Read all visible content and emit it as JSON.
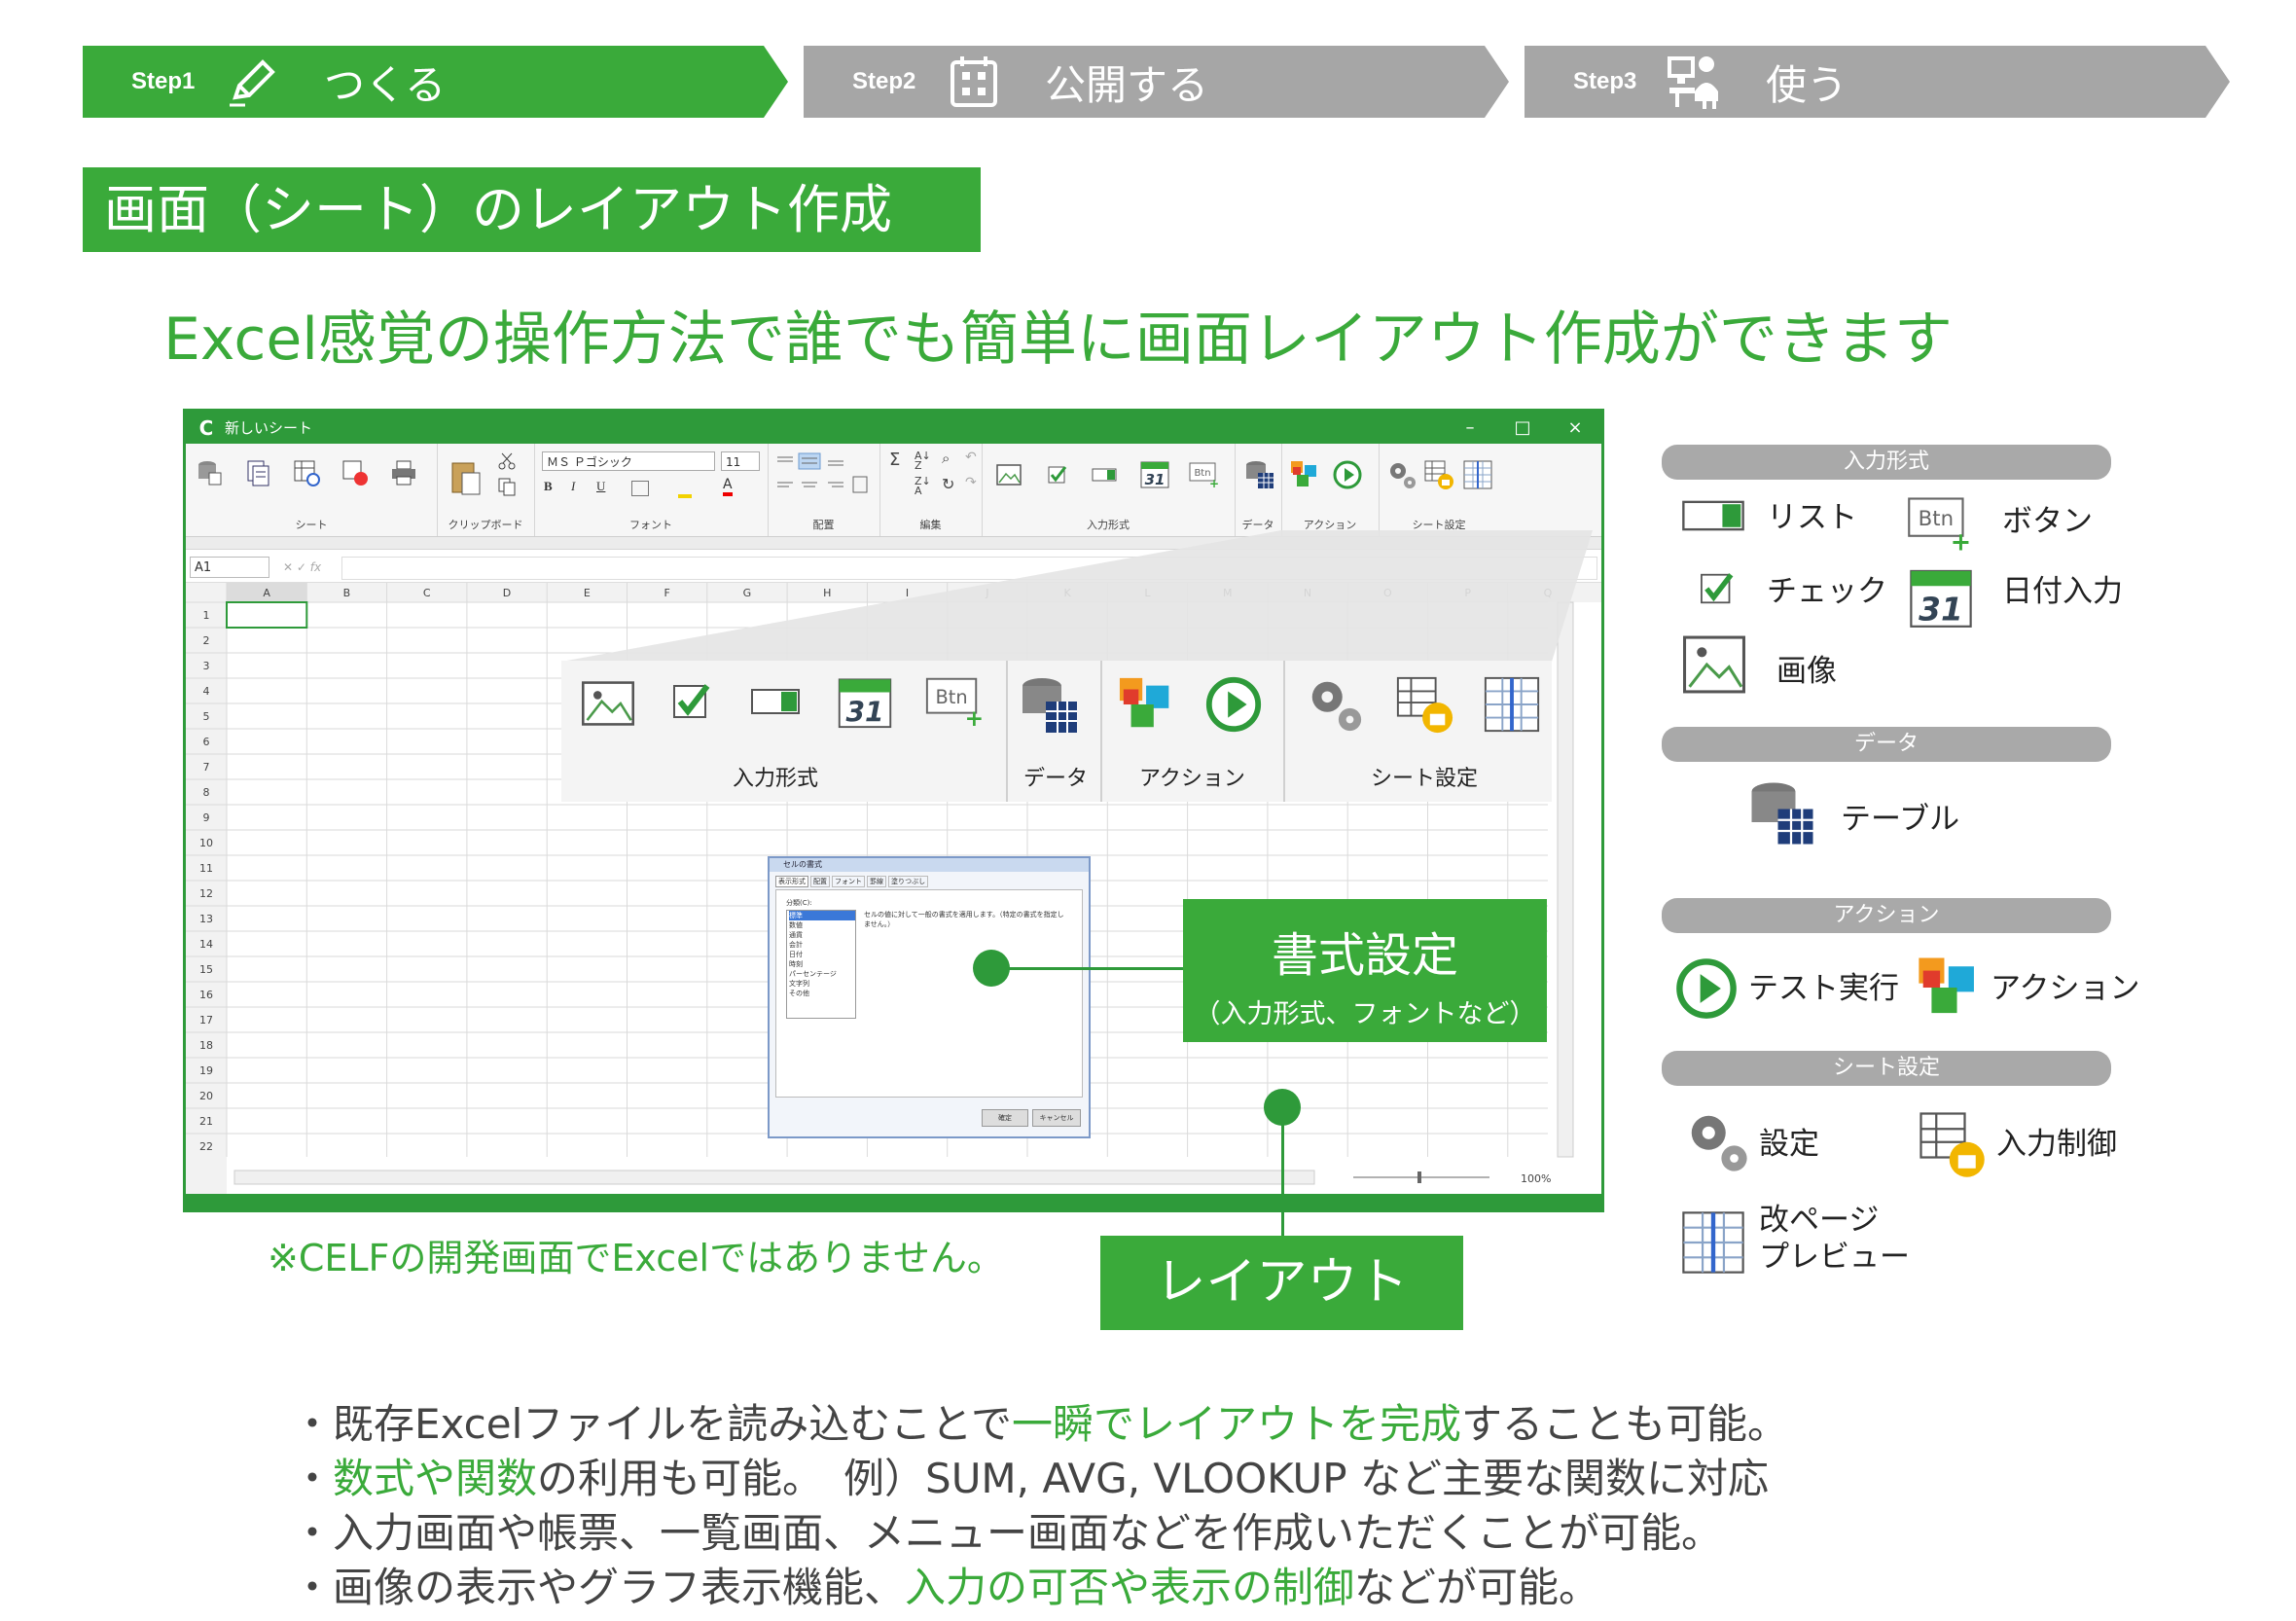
{
  "steps": [
    {
      "num": "Step1",
      "label": "つくる",
      "icon": "pencil-icon",
      "color": "#3aaa3a"
    },
    {
      "num": "Step2",
      "label": "公開する",
      "icon": "grid-page-icon",
      "color": "#a6a6a6"
    },
    {
      "num": "Step3",
      "label": "使う",
      "icon": "users-pc-icon",
      "color": "#a6a6a6"
    }
  ],
  "section_title": "画面（シート）のレイアウト作成",
  "headline": "Excel感覚の操作方法で誰でも簡単に画面レイアウト作成ができます",
  "app": {
    "title": "新しいシート",
    "window_controls": [
      "–",
      "□",
      "×"
    ],
    "ribbon_groups": [
      "シート",
      "クリップボード",
      "フォント",
      "配置",
      "編集",
      "入力形式",
      "データ",
      "アクション",
      "シート設定"
    ],
    "font_name": "ＭＳ Ｐゴシック",
    "font_size": "11",
    "cell_ref": "A1",
    "columns": [
      "A",
      "B",
      "C",
      "D",
      "E",
      "F",
      "G",
      "H",
      "I",
      "J",
      "K",
      "L",
      "M",
      "N",
      "O",
      "P",
      "Q"
    ],
    "rows": [
      "1",
      "2",
      "3",
      "4",
      "5",
      "6",
      "7",
      "8",
      "9",
      "10",
      "11",
      "12",
      "13",
      "14",
      "15",
      "16",
      "17",
      "18",
      "19",
      "20",
      "21",
      "22"
    ],
    "zoom": "100%"
  },
  "zoom_panel": {
    "groups": [
      "入力形式",
      "データ",
      "アクション",
      "シート設定"
    ]
  },
  "dialog": {
    "title": "セルの書式",
    "tabs": [
      "表示形式",
      "配置",
      "フォント",
      "罫線",
      "塗りつぶし"
    ],
    "category_label": "分類(C):",
    "categories": [
      "標準",
      "数値",
      "通貨",
      "会計",
      "日付",
      "時刻",
      "パーセンテージ",
      "文字列",
      "その他"
    ],
    "description": "セルの値に対して一般の書式を適用します。（特定の書式を指定しません。）",
    "ok": "確定",
    "cancel": "キャンセル"
  },
  "callouts": {
    "format_title": "書式設定",
    "format_sub": "（入力形式、フォントなど）",
    "layout": "レイアウト"
  },
  "note": "※CELFの開発画面でExcelではありません。",
  "legend": {
    "input_head": "入力形式",
    "list": "リスト",
    "button": "ボタン",
    "check": "チェック",
    "date": "日付入力",
    "image": "画像",
    "data_head": "データ",
    "table": "テーブル",
    "action_head": "アクション",
    "test_run": "テスト実行",
    "action": "アクション",
    "sheet_head": "シート設定",
    "settings": "設定",
    "input_control": "入力制御",
    "page_break_1": "改ページ",
    "page_break_2": "プレビュー"
  },
  "bullets": [
    {
      "pre": "・既存Excelファイルを読み込むことで",
      "hl": "一瞬でレイアウトを完成",
      "post": "することも可能。"
    },
    {
      "pre": "・",
      "hl": "数式や関数",
      "post": "の利用も可能。　例）SUM, AVG, VLOOKUP など主要な関数に対応"
    },
    {
      "pre": "・入力画面や帳票、一覧画面、メニュー画面などを作成いただくことが可能。",
      "hl": "",
      "post": ""
    },
    {
      "pre": "・画像の表示やグラフ表示機能、",
      "hl": "入力の可否や表示の制御",
      "post": "などが可能。"
    }
  ],
  "colors": {
    "accent": "#3aaa3a",
    "dark_green": "#2e9a3a",
    "grey": "#a6a6a6"
  }
}
